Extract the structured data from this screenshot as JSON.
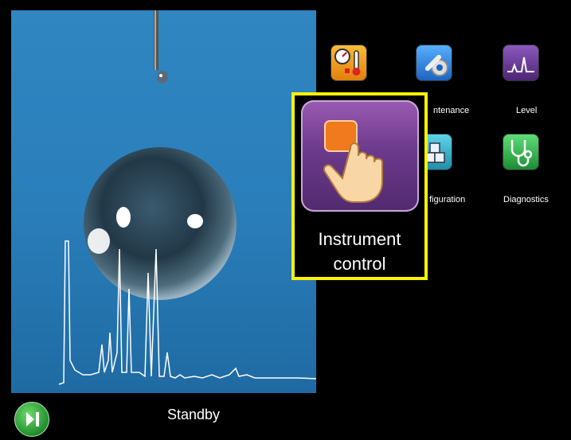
{
  "status": {
    "text": "Standby"
  },
  "menu": {
    "items": [
      {
        "label": "",
        "icon": "pressure-temperature-icon"
      },
      {
        "label": "ntenance",
        "icon": "maintenance-wrench-icon"
      },
      {
        "label": "Level",
        "icon": "level-peak-icon"
      },
      {
        "label": "figuration",
        "icon": "configuration-cubes-icon"
      },
      {
        "label": "Diagnostics",
        "icon": "diagnostics-stethoscope-icon"
      }
    ]
  },
  "highlight": {
    "line1": "Instrument",
    "line2": "control",
    "icon": "instrument-control-hand-icon",
    "border_color": "#fff200"
  },
  "colors": {
    "panel": "#2a7fbb",
    "status_button": "#2a9a3a",
    "maintenance": "#2f86d6",
    "level": "#6b3c98",
    "configuration": "#30b6cf",
    "diagnostics": "#2fa84b",
    "pressure": "#f4a21a"
  }
}
